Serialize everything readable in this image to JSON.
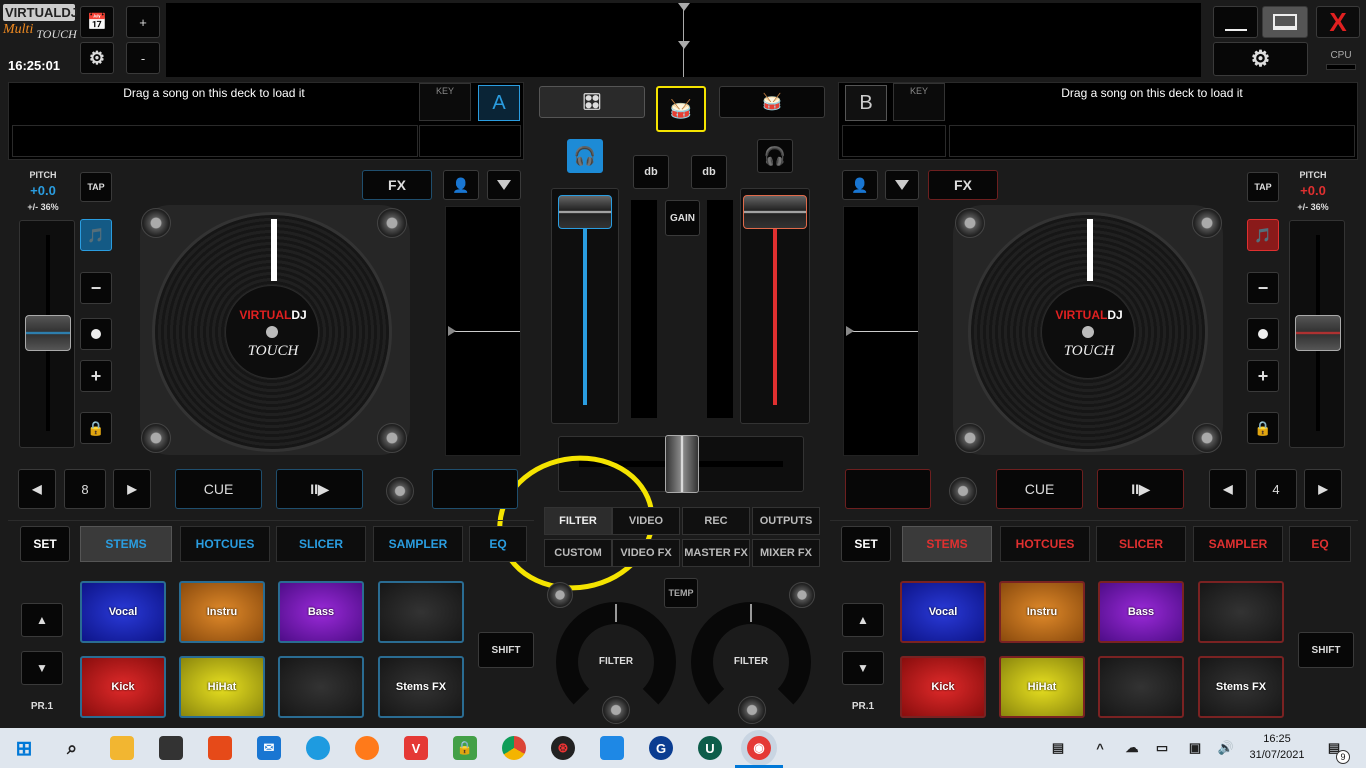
{
  "app": {
    "logo_top": "VIRTUALDJ",
    "logo_bottom_a": "Multi",
    "logo_bottom_b": "TOUCH",
    "clock": "16:25:01",
    "plus": "+",
    "minus": "-",
    "cpu": "CPU",
    "close": "X"
  },
  "deckA": {
    "letter": "A",
    "key_label": "KEY",
    "drop_text": "Drag a song on this deck to load it",
    "pitch_label": "PITCH",
    "pitch_value": "+0.0",
    "pitch_range": "+/- 36%",
    "tap": "TAP",
    "fx": "FX",
    "cue": "CUE",
    "playpause": "II▶",
    "loop_value": "8",
    "prev": "◀",
    "next": "▶",
    "minus": "−",
    "plus": "+",
    "set": "SET",
    "tabs": [
      "STEMS",
      "HOTCUES",
      "SLICER",
      "SAMPLER",
      "EQ"
    ],
    "pads": [
      "Vocal",
      "Instru",
      "Bass",
      "",
      "Kick",
      "HiHat",
      "",
      "Stems FX"
    ],
    "up": "▲",
    "down": "▼",
    "preset": "PR.1",
    "shift": "SHIFT",
    "platter_brand_a": "VIRTUAL",
    "platter_brand_b": "DJ",
    "platter_sub": "TOUCH"
  },
  "deckB": {
    "letter": "B",
    "key_label": "KEY",
    "drop_text": "Drag a song on this deck to load it",
    "pitch_label": "PITCH",
    "pitch_value": "+0.0",
    "pitch_range": "+/- 36%",
    "tap": "TAP",
    "fx": "FX",
    "cue": "CUE",
    "playpause": "II▶",
    "loop_value": "4",
    "prev": "◀",
    "next": "▶",
    "minus": "−",
    "plus": "+",
    "set": "SET",
    "tabs": [
      "STEMS",
      "HOTCUES",
      "SLICER",
      "SAMPLER",
      "EQ"
    ],
    "pads": [
      "Vocal",
      "Instru",
      "Bass",
      "",
      "Kick",
      "HiHat",
      "",
      "Stems FX"
    ],
    "up": "▲",
    "down": "▼",
    "preset": "PR.1",
    "shift": "SHIFT",
    "platter_brand_a": "VIRTUAL",
    "platter_brand_b": "DJ",
    "platter_sub": "TOUCH"
  },
  "mixer": {
    "db_left": "db",
    "db_right": "db",
    "gain": "GAIN",
    "temp": "TEMP",
    "filter_left": "FILTER",
    "filter_right": "FILTER",
    "row1": [
      "FILTER",
      "VIDEO",
      "REC",
      "OUTPUTS"
    ],
    "row2": [
      "CUSTOM",
      "VIDEO FX",
      "MASTER FX",
      "MIXER FX"
    ]
  },
  "taskbar": {
    "time": "16:25",
    "date": "31/07/2021",
    "notifications": "9"
  },
  "colors": {
    "deckA": "#2a9de0",
    "deckB": "#e03030",
    "highlight": "#f5e400",
    "background": "#1b1b1b"
  }
}
